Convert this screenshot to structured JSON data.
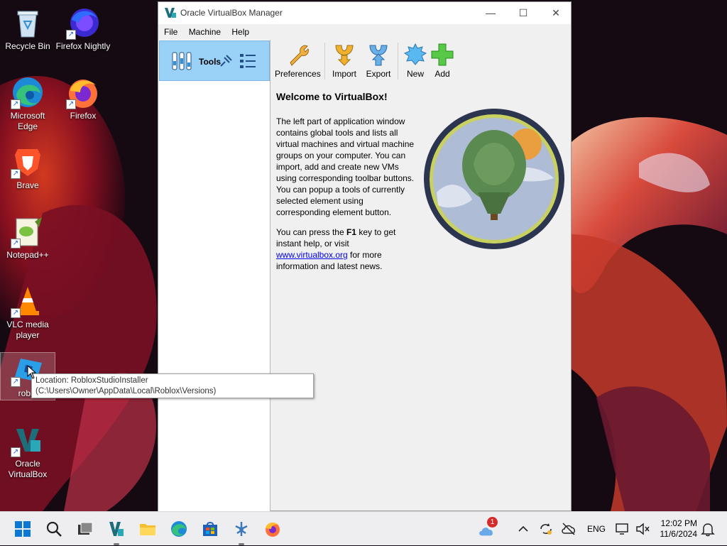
{
  "desktop": {
    "icons": [
      {
        "label": "Recycle Bin"
      },
      {
        "label": "Firefox Nightly"
      },
      {
        "label": "Microsoft Edge"
      },
      {
        "label": "Firefox"
      },
      {
        "label": "Brave"
      },
      {
        "label": "Notepad++"
      },
      {
        "label": "VLC media player"
      },
      {
        "label": "roblo"
      },
      {
        "label": "Oracle VirtualBox"
      }
    ]
  },
  "tooltip": {
    "text": "Location: RobloxStudioInstaller (C:\\Users\\Owner\\AppData\\Local\\Roblox\\Versions)"
  },
  "window": {
    "title": "Oracle VirtualBox Manager",
    "minimize": "—",
    "maximize": "☐",
    "close": "✕",
    "menu": [
      "File",
      "Machine",
      "Help"
    ],
    "tools_label": "Tools",
    "toolbar": {
      "preferences": "Preferences",
      "import": "Import",
      "export": "Export",
      "new": "New",
      "add": "Add"
    },
    "welcome": {
      "heading": "Welcome to VirtualBox!",
      "para1": "The left part of application window contains global tools and lists all virtual machines and virtual machine groups on your computer. You can import, add and create new VMs using corresponding toolbar buttons. You can popup a tools of currently selected element using corresponding element button.",
      "para2_before": "You can press the ",
      "para2_key": "F1",
      "para2_mid": " key to get instant help, or visit ",
      "para2_link": "www.virtualbox.org",
      "para2_after": " for more information and latest news."
    }
  },
  "taskbar": {
    "weather_badge": "1",
    "language": "ENG",
    "time": "12:02 PM",
    "date": "11/6/2024"
  },
  "colors": {
    "selection": "#99d1f7",
    "link": "#0000ee",
    "taskbar": "#eeeef0"
  }
}
